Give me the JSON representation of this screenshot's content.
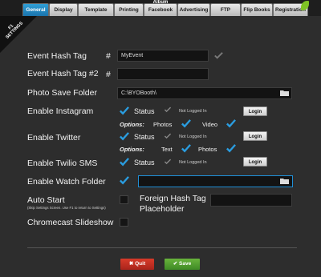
{
  "tabs": [
    "General",
    "Display",
    "Template",
    "Printing",
    "Facebook",
    "Advertising",
    "FTP",
    "Flip Books",
    "Registration"
  ],
  "facebook_badge": "Album",
  "ribbon": {
    "key": "F1",
    "label": "SETTINGS"
  },
  "event_hash": {
    "label": "Event Hash Tag",
    "prefix": "#",
    "value": "MyEvent"
  },
  "event_hash2": {
    "label": "Event Hash Tag #2",
    "prefix": "#",
    "value": ""
  },
  "photo_save": {
    "label": "Photo Save Folder",
    "value": "C:\\BYOBooth\\"
  },
  "instagram": {
    "label": "Enable Instagram",
    "status": "Status",
    "not_logged": "Not Logged In",
    "login": "Login",
    "options": "Options:",
    "opt1": "Photos",
    "opt2": "Video"
  },
  "twitter": {
    "label": "Enable Twitter",
    "status": "Status",
    "not_logged": "Not Logged In",
    "login": "Login",
    "options": "Options:",
    "opt1": "Text",
    "opt2": "Photos"
  },
  "twilio": {
    "label": "Enable Twilio SMS",
    "status": "Status",
    "not_logged": "Not Logged In",
    "login": "Login"
  },
  "watch_folder": {
    "label": "Enable Watch Folder",
    "value": ""
  },
  "auto_start": {
    "label": "Auto Start",
    "sub": "(Skip Settings Screen. Use F1 to return to Settings)"
  },
  "foreign_hash": {
    "label_line1": "Foreign Hash Tag",
    "label_line2": "Placeholder",
    "value": ""
  },
  "chromecast": {
    "label": "Chromecast Slideshow"
  },
  "buttons": {
    "quit": "Quit",
    "save": "Save"
  },
  "colors": {
    "accent": "#1f8fd6",
    "check": "#2a9de0",
    "quit": "#c0301f",
    "save": "#52a032"
  }
}
